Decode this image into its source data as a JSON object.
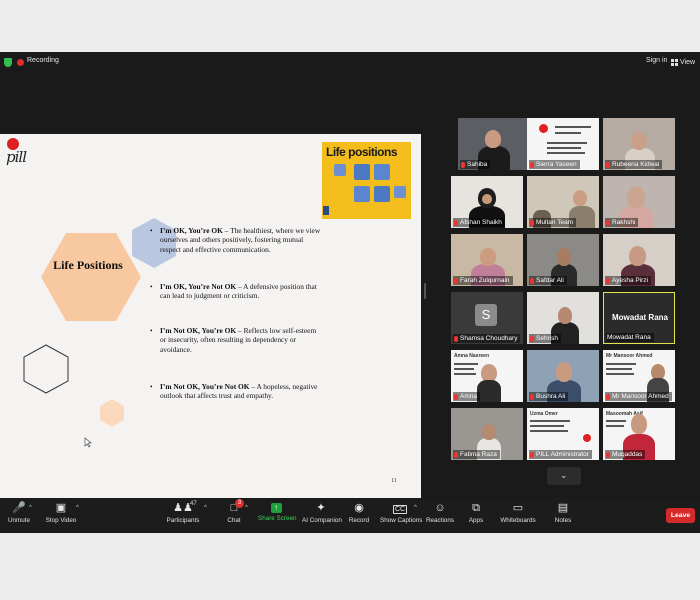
{
  "topbar": {
    "recording_label": "Recording",
    "sign_in_label": "Sign in",
    "view_label": "View"
  },
  "slide": {
    "logo_text": "pill",
    "title": "Life Positions",
    "image_title": "Life positions",
    "bullets": [
      {
        "bold": "I’m OK, You’re OK",
        "text": " – The healthiest, where we view ourselves and others positively, fostering mutual respect and effective communication."
      },
      {
        "bold": "I’m OK, You’re Not OK",
        "text": " – A defensive position that can lead to judgment or criticism."
      },
      {
        "bold": "I’m Not OK, You’re OK",
        "text": " – Reflects low self-esteem or insecurity, often resulting in dependency or avoidance."
      },
      {
        "bold": "I’m Not OK, You’re Not OK",
        "text": " – A hopeless, negative outlook that affects trust and empathy."
      }
    ],
    "page_number": "11",
    "colors": {
      "hexagon_main": "#f8c9a0",
      "hexagon_blue": "#b9c7e0",
      "image_bg": "#f3bd1c"
    }
  },
  "participants": [
    {
      "name": "Sahiba"
    },
    {
      "name": "Sierra Yaseen"
    },
    {
      "name": "Rubeena Kidwai"
    },
    {
      "name": "Afshan Shaikh"
    },
    {
      "name": "Multan Team"
    },
    {
      "name": "Rakhshi"
    },
    {
      "name": "Farah Zulqurnain"
    },
    {
      "name": "Safdar Ali"
    },
    {
      "name": "Ayesha Pirzi"
    },
    {
      "name": "Shamsa Choudhary",
      "avatar_letter": "S"
    },
    {
      "name": "Sehrish"
    },
    {
      "name": "Mowadat Rana",
      "big_name": "Mowadat Rana"
    },
    {
      "name": "Amna"
    },
    {
      "name": "Bushra Ali"
    },
    {
      "name": "Mr Mansoor Ahmed"
    },
    {
      "name": "Fatima Raza"
    },
    {
      "name": "PILL Administrator"
    },
    {
      "name": "Muqaddas"
    }
  ],
  "tile_docs": {
    "amna_header": "Amna Nasreen",
    "mansoor_header": "Mr Mansoor Ahmed",
    "uzma_header": "Uzma Omer",
    "masood_header": "Masoomah Asif"
  },
  "toolbar": {
    "unmute": "Unmute",
    "stop_video": "Stop Video",
    "participants": "Participants",
    "participants_count": "47",
    "chat": "Chat",
    "chat_badge": "3",
    "share_screen": "Share Screen",
    "ai_companion": "AI Companion",
    "record": "Record",
    "show_captions": "Show Captions",
    "reactions": "Reactions",
    "apps": "Apps",
    "whiteboards": "Whiteboards",
    "notes": "Notes",
    "leave": "Leave"
  }
}
